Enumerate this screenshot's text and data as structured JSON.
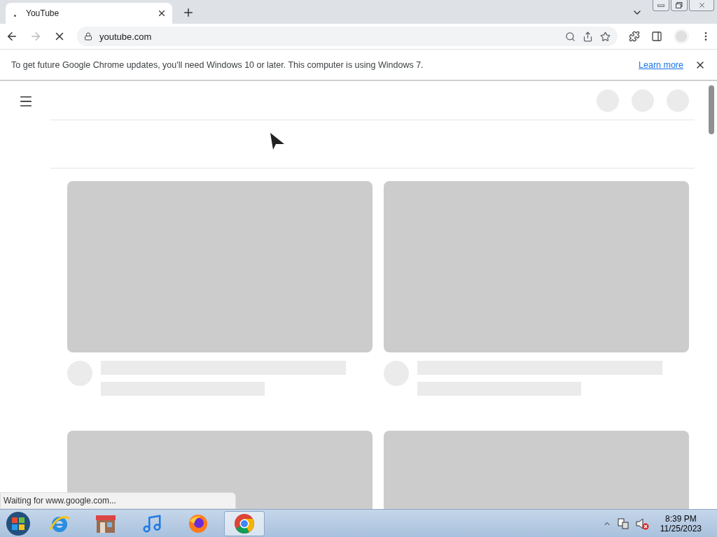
{
  "tab": {
    "title": "YouTube"
  },
  "address_bar": {
    "url": "youtube.com"
  },
  "infobar": {
    "message": "To get future Google Chrome updates, you'll need Windows 10 or later. This computer is using Windows 7.",
    "link": "Learn more"
  },
  "status_bubble": "Waiting for www.google.com...",
  "taskbar": {
    "apps": [
      {
        "kind": "ie",
        "selected": false
      },
      {
        "kind": "store",
        "selected": false
      },
      {
        "kind": "music",
        "selected": false
      },
      {
        "kind": "firefox",
        "selected": false
      },
      {
        "kind": "chrome",
        "selected": true
      }
    ],
    "clock": {
      "time": "8:39 PM",
      "date": "11/25/2023"
    }
  }
}
